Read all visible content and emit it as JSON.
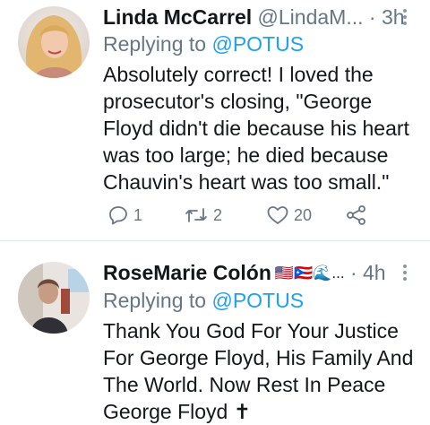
{
  "tweets": [
    {
      "name": "Linda McCarrel",
      "handle": "@LindaM...",
      "separator": "·",
      "time": "3h",
      "replying_prefix": "Replying to ",
      "replying_to": "@POTUS",
      "text": "Absolutely correct!  I loved the prosecutor's closing, \"George Floyd didn't die because his heart was too large; he died because Chauvin's heart was too small.\"",
      "replies": "1",
      "retweets": "2",
      "likes": "20"
    },
    {
      "name": "RoseMarie Colón",
      "flags": "🇺🇸🇵🇷🌊...",
      "separator": "·",
      "time": "4h",
      "replying_prefix": "Replying to ",
      "replying_to": "@POTUS",
      "text": "Thank You God For Your Justice For George Floyd, His Family And The World. Now Rest In Peace George Floyd ✝"
    }
  ],
  "colors": {
    "accent": "#1da1f2",
    "secondary_text": "#657786",
    "divider": "#e1e8ed"
  },
  "icons": [
    "reply-icon",
    "retweet-icon",
    "like-icon",
    "share-icon",
    "more-icon"
  ]
}
